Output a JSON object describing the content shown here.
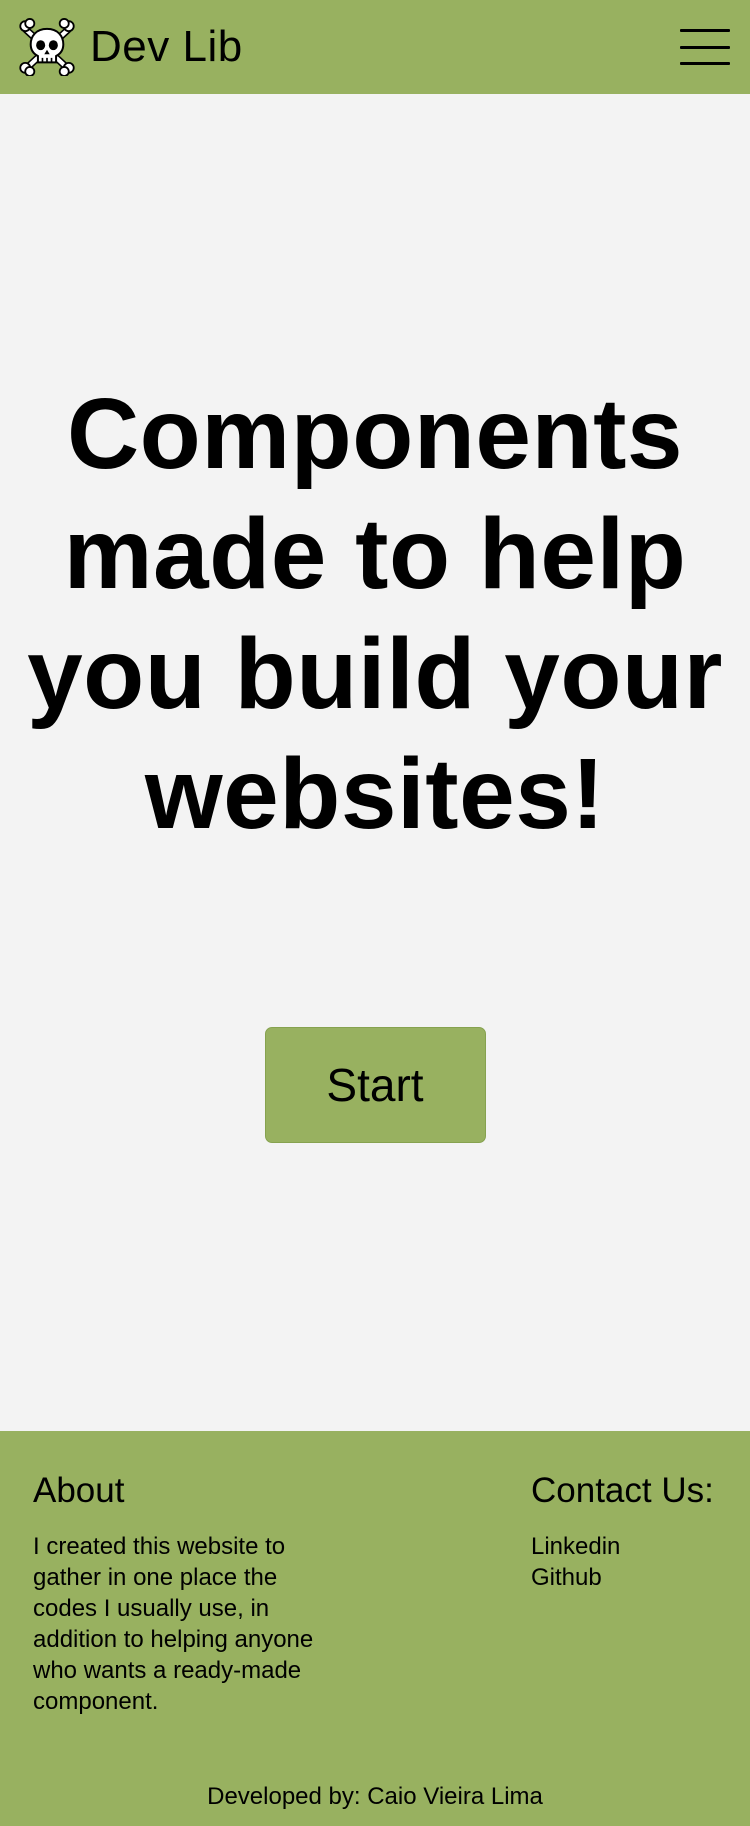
{
  "colors": {
    "accent": "#98b160",
    "background": "#f3f3f3",
    "text": "#000000"
  },
  "header": {
    "logo_icon": "skull-and-crossbones-icon",
    "brand": "Dev Lib",
    "menu_icon": "hamburger-menu-icon"
  },
  "hero": {
    "headline": "Components made to help you build your websites!",
    "start_label": "Start"
  },
  "footer": {
    "about": {
      "title": "About",
      "text": "I created this website to gather in one place the codes I usually use, in addition to helping anyone who wants a ready-made component."
    },
    "contact": {
      "title": "Contact Us:",
      "links": [
        "Linkedin",
        "Github"
      ]
    },
    "credit": "Developed by: Caio Vieira Lima"
  }
}
